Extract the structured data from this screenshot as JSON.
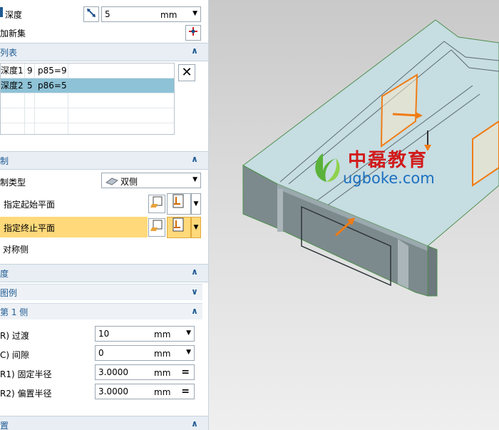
{
  "panel": {
    "depth_row": {
      "label": "深度",
      "value": "5",
      "unit": "mm"
    },
    "add_set_label": "加新集",
    "list_section_title": "列表",
    "list_rows": [
      {
        "name": "深度1",
        "num": "9",
        "expr": "p85=9"
      },
      {
        "name": "深度2",
        "num": "5",
        "expr": "p86=5"
      }
    ],
    "limit_section_title": "制",
    "limit_type_label": "制类型",
    "limit_type_value": "双侧",
    "start_plane_label": "指定起始平面",
    "end_plane_label": "指定终止平面",
    "symmetric_label": "对称侧",
    "width_section_title": "度",
    "legend_title": "图例",
    "side1_title": "第 1 侧",
    "fields": [
      {
        "label": "R) 过渡",
        "value": "10",
        "unit": "mm",
        "control": "dropdown"
      },
      {
        "label": "C) 间隙",
        "value": "0",
        "unit": "mm",
        "control": "dropdown"
      },
      {
        "label": "R1) 固定半径",
        "value": "3.0000",
        "unit": "mm",
        "control": "equals"
      },
      {
        "label": "R2) 偏置半径",
        "value": "3.0000",
        "unit": "mm",
        "control": "equals"
      }
    ],
    "bottom_section_title": "置"
  },
  "viewport": {
    "watermark_cn": "中磊教育",
    "watermark_url": "ugboke.com"
  },
  "colors": {
    "header_bg": "#e8eef4",
    "header_text": "#1f5a92",
    "selected_row": "#8ec2d6",
    "highlight_row": "#ffd97a",
    "model_top": "#c6dde2",
    "model_side": "#7d8a8d",
    "plane_orange": "#f07c14",
    "watermark_red": "#d21a1a",
    "watermark_blue": "#1b6fbf"
  }
}
